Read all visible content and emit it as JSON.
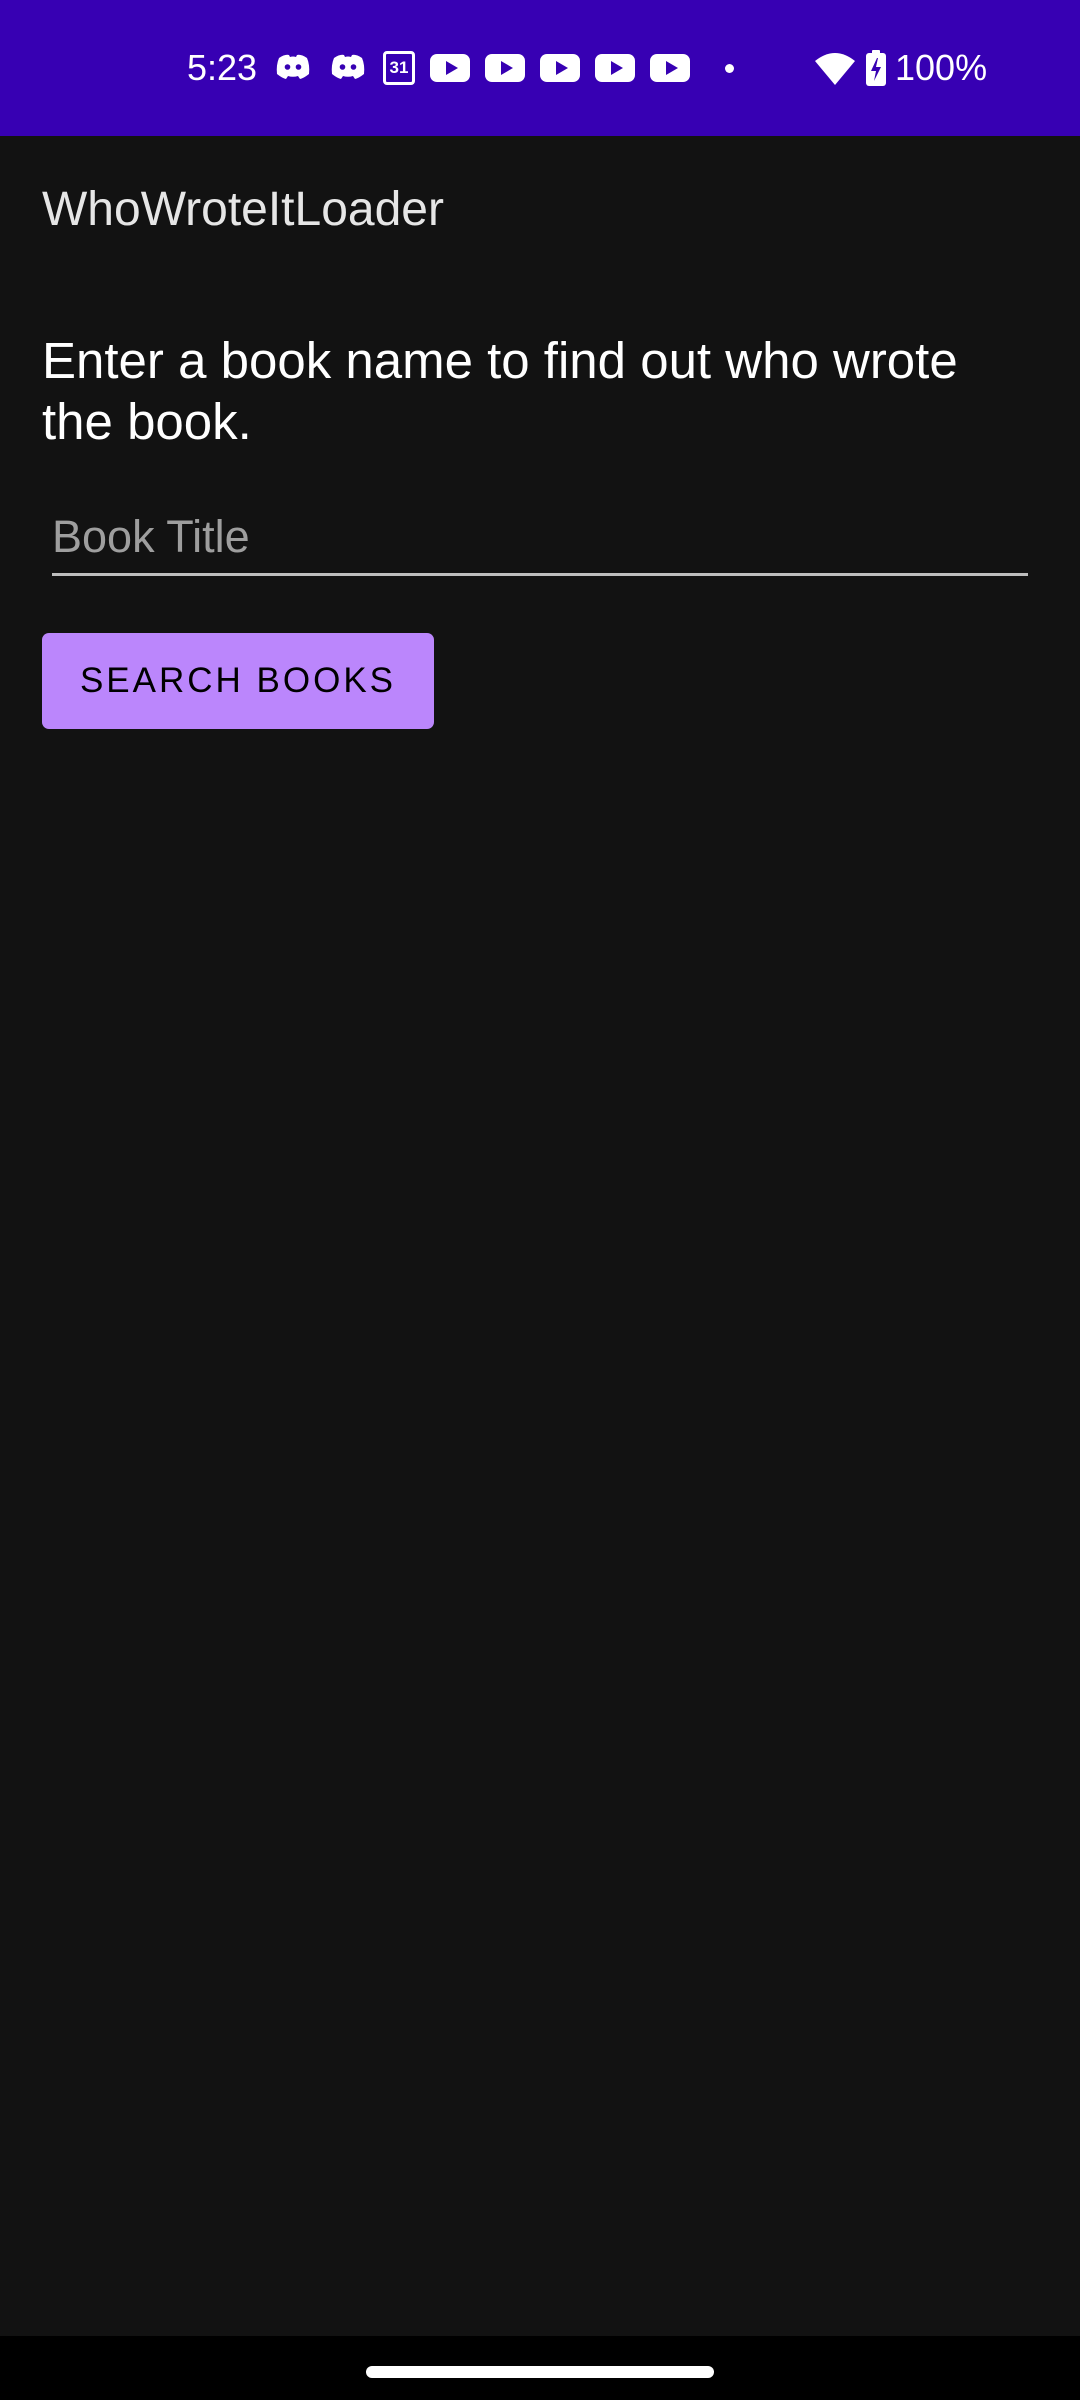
{
  "status_bar": {
    "time": "5:23",
    "battery": "100%",
    "calendar_day": "31",
    "background_color": "#3700b3",
    "notification_icons": [
      "discord-icon",
      "discord-icon",
      "calendar-icon",
      "youtube-icon",
      "youtube-icon",
      "youtube-icon",
      "youtube-icon",
      "youtube-icon",
      "more-notifications-dot-icon"
    ],
    "system_icons": [
      "wifi-icon",
      "battery-charging-icon"
    ]
  },
  "app": {
    "title": "WhoWroteItLoader",
    "instruction": "Enter a book name to find out who wrote the book.",
    "search_input": {
      "placeholder": "Book Title",
      "value": ""
    },
    "search_button_label": "SEARCH BOOKS",
    "accent_color": "#bb86fc",
    "background_color": "#121212"
  }
}
